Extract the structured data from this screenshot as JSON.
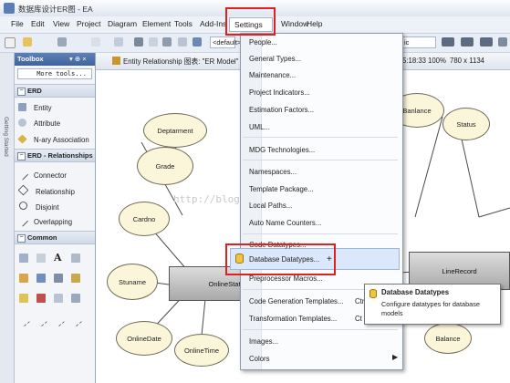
{
  "window": {
    "title": "数据库设计ER图 - EA"
  },
  "menubar": {
    "items": [
      "File",
      "Edit",
      "View",
      "Project",
      "Diagram",
      "Element",
      "Tools",
      "Add-Ins",
      "Settings",
      "Window",
      "Help"
    ]
  },
  "toolbar": {
    "combo_left": "<default>",
    "combo_right": "ic"
  },
  "toolbox": {
    "title": "Toolbox",
    "pin": "▾ ⊕ ×",
    "more_tools": "More tools...",
    "sections": {
      "erd": {
        "title": "ERD",
        "items": [
          "Entity",
          "Attribute",
          "N-ary Association"
        ]
      },
      "relationships": {
        "title": "ERD - Relationships",
        "items": [
          "Connector",
          "Relationship",
          "Disjoint",
          "Overlapping"
        ]
      },
      "common": {
        "title": "Common"
      }
    },
    "common_letter": "A"
  },
  "left_rail": {
    "label": "Getting Started"
  },
  "diagram": {
    "tab_title": "Entity Relationship 图表: \"ER Model\"",
    "status_time": "5:18:33",
    "zoom": "100%",
    "size": "780 x 1134",
    "attributes": [
      "Deptarment",
      "Grade",
      "Cardno",
      "Stuname",
      "OnlineDate",
      "OnlineTime",
      "Banlance",
      "Status",
      "Balance"
    ],
    "entities": [
      "OnlineStatus",
      "LineRecord"
    ]
  },
  "settings_menu": {
    "items": {
      "people": "People...",
      "general_types": "General Types...",
      "maintenance": "Maintenance...",
      "project_indicators": "Project Indicators...",
      "estimation_factors": "Estimation Factors...",
      "uml": "UML...",
      "mdg": "MDG Technologies...",
      "namespaces": "Namespaces...",
      "template_package": "Template Package...",
      "local_paths": "Local Paths...",
      "auto_name": "Auto Name Counters...",
      "code_datatypes": "Code Datatypes...",
      "database_datatypes": "Database Datatypes...",
      "preprocessor_macros": "Preprocessor Macros...",
      "code_gen_templates": "Code Generation Templates...",
      "code_gen_shortcut": "Ctr",
      "transformation_templates": "Transformation Templates...",
      "transformation_shortcut": "Ct",
      "images": "Images...",
      "colors": "Colors"
    }
  },
  "tooltip": {
    "title": "Database Datatypes",
    "description": "Configure datatypes for database models"
  },
  "watermark": {
    "text": "http://blog.csdn.net/"
  }
}
